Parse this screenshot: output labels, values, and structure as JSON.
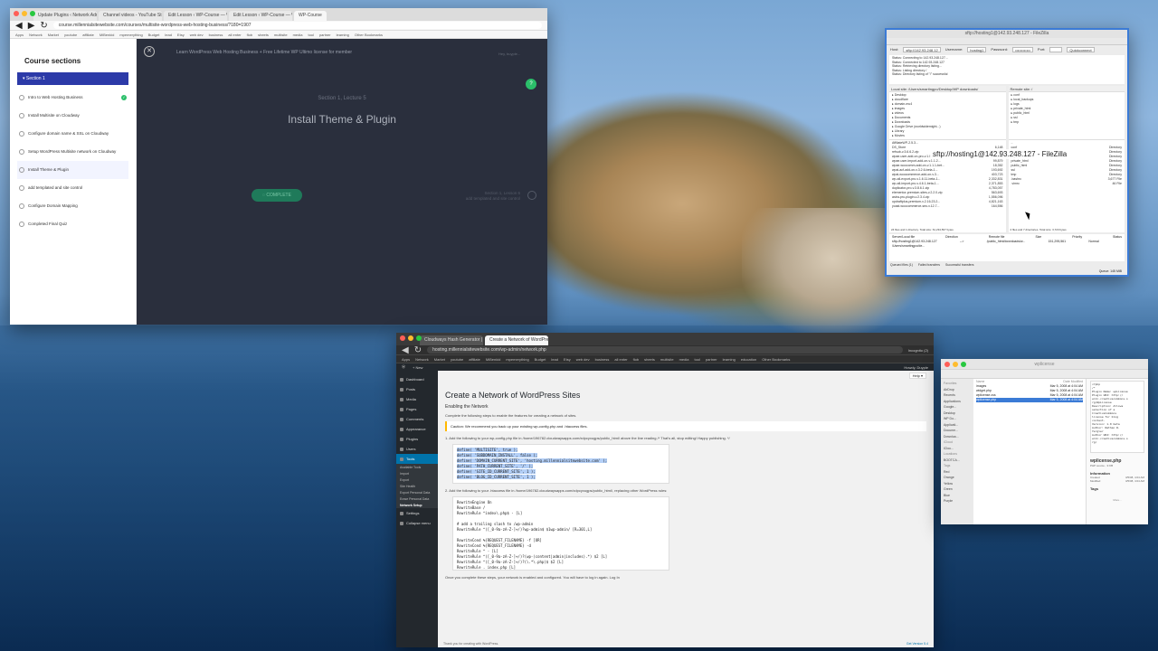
{
  "course_browser": {
    "tabs": [
      "Update Plugins ‹ Network Admi...",
      "Channel videos - YouTube Studi...",
      "Edit Lesson ‹ WP-Course — W...",
      "Edit Lesson ‹ WP-Course — W...",
      "WP-Course"
    ],
    "url": "course.millennialsitewebsite.com/courses/multisite-wordpress-web-hosting-business/?180=1907",
    "bookmarks": [
      "Apps",
      "Network",
      "Market",
      "youtube",
      "affiliate",
      "MiBenkid",
      "mpemerything",
      "Budget",
      "lead",
      "Etsy",
      "web dev",
      "business",
      "all enter",
      "flob",
      "sheets",
      "multisite",
      "media",
      "tool",
      "partner",
      "learning",
      "Other Bookmarks"
    ],
    "sidebar_title": "Course sections",
    "section_label": "Section 1",
    "lessons": [
      {
        "label": "Intro to Web Hosting Business",
        "done": true
      },
      {
        "label": "Install Multisite on Cloudway",
        "done": false
      },
      {
        "label": "Configure domain name & SSL on Cloudway",
        "done": false
      },
      {
        "label": "Setup WordPress Multisite network on Cloudway",
        "done": false
      },
      {
        "label": "Install Theme & Plugin",
        "done": false
      },
      {
        "label": "add templated and site control",
        "done": false
      },
      {
        "label": "Configure Domain Mapping",
        "done": false
      },
      {
        "label": "Completed Final Quiz",
        "done": false
      }
    ],
    "course_title": "Learn WordPress Web Hosting Business + Free Lifetime WP Ultimo license for member",
    "lecture_meta": "Section 1, Lecture 5",
    "lecture_title": "Install Theme & Plugin",
    "complete_label": "COMPLETE",
    "next_lesson": "Section 1, Lesson 6\nadd templated and site control",
    "user_label": "Hey, buyple..."
  },
  "filezilla": {
    "title": "sftp://hosting1@142.93.248.127 - FileZilla",
    "host_label": "Host:",
    "host_value": "sftp://142.93.248.12",
    "user_label": "Username:",
    "user_value": "hosting1",
    "password_label": "Password:",
    "password_value": "••••••••••••",
    "port_label": "Port:",
    "quickconnect": "Quickconnect",
    "log": [
      "Status: Connecting to 142.93.248.127...",
      "Status: Connected to 142.93.248.127",
      "Status: Retrieving directory listing...",
      "Status: Listing directory /",
      "Status: Directory listing of \"/\" successful"
    ],
    "local_site_label": "Local site:",
    "local_site": "/Users/smartingpo/Desktop/WP downloads/",
    "remote_site_label": "Remote site:",
    "remote_site": "/",
    "local_tree": [
      "Desktop",
      "cloudflare",
      "domain-mu4",
      "images",
      "videos",
      "Documents",
      "Downloads",
      "Google Drive (worldwidemight...)",
      "Library",
      "Movies"
    ],
    "remote_tree": [
      "conf",
      "local_backups",
      "logs",
      "private_html",
      "public_html",
      "ssl",
      "tmp"
    ],
    "local_files": [
      {
        "name": "AffiliateWP-2.5.3...",
        "size": ""
      },
      {
        "name": "DS_Store",
        "size": "6,148"
      },
      {
        "name": "refsub-v.3.6.6.2.zip",
        "size": "3,211,403"
      },
      {
        "name": "wpae-user-add-on-pro-v.1.0.4-b...",
        "size": "87,655"
      },
      {
        "name": "wpae-user-import-add-on-v.1.1.2...",
        "size": "99,879"
      },
      {
        "name": "wpae-woocomm-add-on-v.1.1.1-bet...",
        "size": "18,352"
      },
      {
        "name": "wpai-acf-add-on-v.3.2.6-beta-1...",
        "size": "193,692"
      },
      {
        "name": "wpai-woocommerce-add-on-v.3...",
        "size": "403,723"
      },
      {
        "name": "wp-all-export-pro-v.1.6.11-beta-1...",
        "size": "2,332,831"
      },
      {
        "name": "wp-all-import-pro-v.4.6.1-beta-1...",
        "size": "2,371,853"
      },
      {
        "name": "duplicator-pro-v.3.8.6.1.zip",
        "size": "4,783,057"
      },
      {
        "name": "elementor-premium-sites-v.2.2.0.zip",
        "size": "563,693"
      },
      {
        "name": "astra-pro-plugin-v.2.3.4.zip",
        "size": "1,556,096"
      },
      {
        "name": "updraftplus-premium-v.2.16.23.2...",
        "size": "4,821,163"
      },
      {
        "name": "yoast-woocommerce-seo-v.12.7...",
        "size": "164,556"
      }
    ],
    "remote_files": [
      {
        "name": "..",
        "type": ""
      },
      {
        "name": "conf",
        "type": "Directory"
      },
      {
        "name": "local_backups",
        "type": "Directory"
      },
      {
        "name": "logs",
        "type": "Directory"
      },
      {
        "name": "private_html",
        "type": "Directory"
      },
      {
        "name": "public_html",
        "type": "Directory"
      },
      {
        "name": "ssl",
        "type": "Directory"
      },
      {
        "name": "tmp",
        "type": "Directory"
      },
      {
        "name": ".bashrc",
        "type": "3,677 File"
      },
      {
        "name": ".vimrc",
        "type": "46 File"
      }
    ],
    "local_status": "24 files and 1 directory. Total size: 61,234,567 bytes",
    "remote_status": "2 files and 7 directories. Total size: 3,723 bytes",
    "queue_cols": [
      "Server/Local file",
      "Direction",
      "Remote file",
      "Size",
      "Priority",
      "Status"
    ],
    "queue_row": [
      "sftp://hosting1@142.93.248.127",
      "-->",
      "/public_html/downloads/w...",
      "151,295,561",
      "Normal",
      ""
    ],
    "queue_row2": "/Users/smartingpo/de...",
    "queue_tabs": [
      "Queued files (1)",
      "Failed transfers",
      "Successful transfers"
    ],
    "queue_status": "Queue: 145 MiB"
  },
  "wordpress": {
    "tabs": [
      "Cloudways Hash Generator | Gr...",
      "Create a Network of WordPress ..."
    ],
    "url": "hosting.millennialsitewebsite.com/wp-admin/network.php",
    "incognito": "Incognito (2)",
    "bookmarks": [
      "Apps",
      "Network",
      "Market",
      "youtube",
      "affiliate",
      "MiBenkid",
      "mpemerything",
      "Budget",
      "lead",
      "Etsy",
      "web dev",
      "business",
      "all enter",
      "flob",
      "sheets",
      "multisite",
      "media",
      "tool",
      "partner",
      "learning",
      "education",
      "Other Bookmarks"
    ],
    "adminbar_new": "+ New",
    "adminbar_howdy": "Howdy, Duyple",
    "help": "Help ▾",
    "nav": [
      "Dashboard",
      "Posts",
      "Media",
      "Pages",
      "Comments",
      "Appearance",
      "Plugins",
      "Users",
      "Tools",
      "Settings",
      "Collapse menu"
    ],
    "tools_sub": [
      "Available Tools",
      "Import",
      "Export",
      "Site Health",
      "Export Personal Data",
      "Erase Personal Data",
      "Network Setup"
    ],
    "page_title": "Create a Network of WordPress Sites",
    "section_title": "Enabling the Network",
    "intro": "Complete the following steps to enable the features for creating a network of sites.",
    "caution": "Caution: We recommend you back up your existing wp-config.php and .htaccess files.",
    "step1": "1. Add the following to your wp-config.php file in /home/196782.cloudwaysapps.com/xdpcyxugps/public_html/ above the line reading /* That's all, stop editing! Happy publishing. */",
    "code1": [
      "define( 'MULTISITE', true );",
      "define( 'SUBDOMAIN_INSTALL', false );",
      "define( 'DOMAIN_CURRENT_SITE', 'hosting.millennialsitewebsite.com' );",
      "define( 'PATH_CURRENT_SITE', '/' );",
      "define( 'SITE_ID_CURRENT_SITE', 1 );",
      "define( 'BLOG_ID_CURRENT_SITE', 1 );"
    ],
    "step2": "2. Add the following to your .htaccess file in /home/196782.cloudwaysapps.com/xdpcyxugps/public_html/, replacing other WordPress rules:",
    "code2": [
      "RewriteEngine On",
      "RewriteBase /",
      "RewriteRule ^index\\.php$ - [L]",
      "",
      "# add a trailing slash to /wp-admin",
      "RewriteRule ^([_0-9a-zA-Z-]+/)?wp-admin$ $1wp-admin/ [R=301,L]",
      "",
      "RewriteCond %{REQUEST_FILENAME} -f [OR]",
      "RewriteCond %{REQUEST_FILENAME} -d",
      "RewriteRule ^ - [L]",
      "RewriteRule ^([_0-9a-zA-Z-]+/)?(wp-(content|admin|includes).*) $2 [L]",
      "RewriteRule ^([_0-9a-zA-Z-]+/)?(\\.*\\.php)$ $2 [L]",
      "RewriteRule . index.php [L]"
    ],
    "closing": "Once you complete these steps, your network is enabled and configured. You will have to log in again. Log In",
    "footer_left": "Thank you for creating with WordPress.",
    "footer_right": "Get Version 5.4"
  },
  "finder": {
    "title": "wplicense",
    "sidebar": [
      "Favorites",
      "AirDrop",
      "Recents",
      "Applications",
      "Google...",
      "Desktop",
      "WP Do...",
      "Applicati...",
      "Docume...",
      "Downloa...",
      "iCloud",
      "iClou...",
      "Locations",
      "BOOTCA...",
      "Tags",
      "Red",
      "Orange",
      "Yellow",
      "Green",
      "Blue",
      "Purple"
    ],
    "col_name": "Name",
    "col_date": "Date Modified",
    "files": [
      {
        "name": "images",
        "date": "Mar 5, 2008 at 4:04 AM",
        "sel": false
      },
      {
        "name": "widget.php",
        "date": "Mar 5, 2008 at 4:04 AM",
        "sel": false
      },
      {
        "name": "wplicense.css",
        "date": "Mar 5, 2008 at 4:04 AM",
        "sel": false
      },
      {
        "name": "wplicense.php",
        "date": "Mar 5, 2008 at 4:04 AM",
        "sel": true
      }
    ],
    "preview_text": "<?php\n/*\nPlugin Name: wpLicense\nPlugin URI: http://\nwiki.creativecommons.o\nrg/WpLicense\nDescription: Allows\nselection of a\nCreativeCommons\nlicense for blog\ncontent.\nVersion: 1.0 beta\nAuthor: Nathan R.\nYergler\nAuthor URI: http://\nwiki.creativecommons.o\nrg/",
    "preview_name": "wplicense.php",
    "preview_kind": "PHP source - 9 KB",
    "info_label": "Information",
    "created_label": "Created",
    "created": "3/5/08, 4:04 AM",
    "modified_label": "Modified",
    "modified": "3/5/08, 4:04 AM",
    "tags_label": "Tags",
    "more_label": "More..."
  },
  "colors": {
    "wp_blue": "#0073aa",
    "course_section": "#2c3aa8",
    "complete_green": "#1f7a5a",
    "check_green": "#2bbf6a",
    "filezilla_border": "#3b7bd6"
  }
}
